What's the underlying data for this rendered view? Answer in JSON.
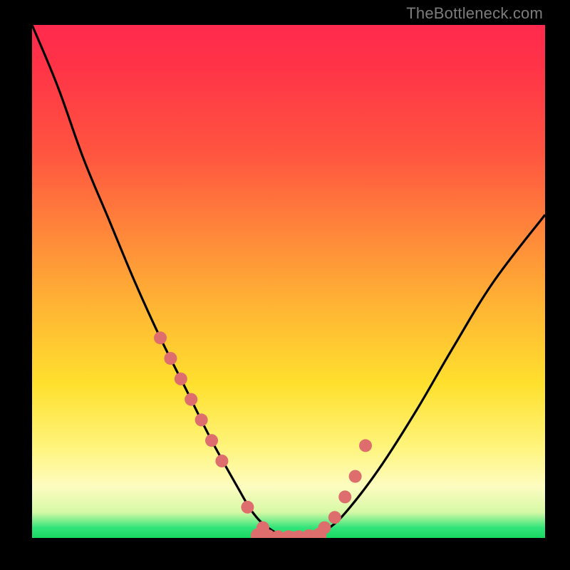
{
  "watermark": "TheBottleneck.com",
  "chart_data": {
    "type": "line",
    "title": "",
    "xlabel": "",
    "ylabel": "",
    "xlim": [
      0,
      100
    ],
    "ylim": [
      0,
      100
    ],
    "series": [
      {
        "name": "bottleneck-curve",
        "x": [
          0,
          5,
          10,
          15,
          20,
          25,
          30,
          35,
          40,
          43,
          46,
          50,
          54,
          58,
          62,
          68,
          75,
          82,
          90,
          100
        ],
        "values": [
          100,
          88,
          74,
          62,
          50,
          39,
          29,
          19,
          10,
          5,
          2,
          0,
          0,
          2,
          6,
          14,
          25,
          37,
          50,
          63
        ]
      }
    ],
    "markers": {
      "name": "highlight-points",
      "color": "#de6e6e",
      "x": [
        25,
        27,
        29,
        31,
        33,
        35,
        37,
        42,
        45,
        48,
        51,
        54,
        57,
        59,
        61,
        63,
        65
      ],
      "values": [
        39,
        35,
        31,
        27,
        23,
        19,
        15,
        6,
        2,
        0,
        0,
        0,
        2,
        4,
        8,
        12,
        18
      ]
    },
    "markers_bottom": {
      "name": "bottom-cluster",
      "color": "#de6e6e",
      "x": [
        44,
        46,
        48,
        50,
        52,
        54,
        56
      ],
      "values": [
        0.5,
        0.3,
        0.1,
        0.1,
        0.1,
        0.3,
        0.6
      ]
    }
  }
}
